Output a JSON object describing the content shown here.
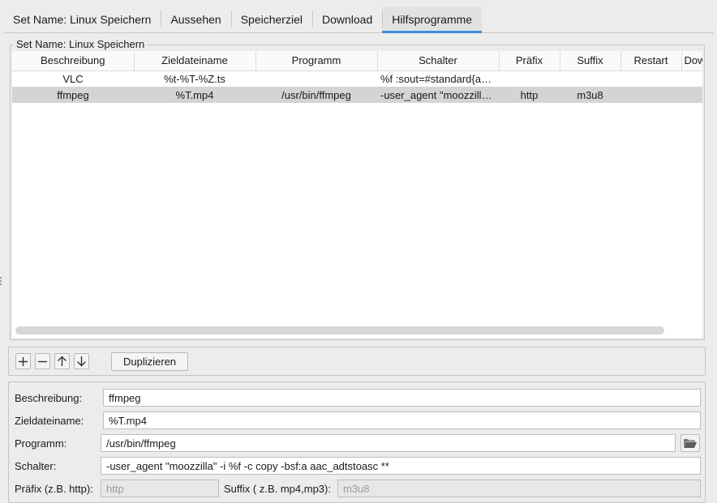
{
  "tabs": [
    {
      "label": "Set Name: Linux Speichern"
    },
    {
      "label": "Aussehen"
    },
    {
      "label": "Speicherziel"
    },
    {
      "label": "Download"
    },
    {
      "label": "Hilfsprogramme"
    }
  ],
  "group_title": "Set Name: Linux Speichern",
  "table": {
    "columns": [
      "Beschreibung",
      "Zieldateiname",
      "Programm",
      "Schalter",
      "Präfix",
      "Suffix",
      "Restart",
      "Dow"
    ],
    "rows": [
      [
        "VLC",
        "%t-%T-%Z.ts",
        "",
        "%f :sout=#standard{ac…",
        "",
        "",
        "",
        ""
      ],
      [
        "ffmpeg",
        "%T.mp4",
        "/usr/bin/ffmpeg",
        "-user_agent \"moozzilla…",
        "http",
        "m3u8",
        "",
        ""
      ]
    ],
    "selected_row": 1
  },
  "toolbar": {
    "add_icon": "plus-icon",
    "remove_icon": "minus-icon",
    "up_icon": "arrow-up-icon",
    "down_icon": "arrow-down-icon",
    "duplicate_label": "Duplizieren"
  },
  "form": {
    "beschreibung_label": "Beschreibung:",
    "beschreibung_value": "ffmpeg",
    "zieldateiname_label": "Zieldateiname:",
    "zieldateiname_value": "%T.mp4",
    "programm_label": "Programm:",
    "programm_value": "/usr/bin/ffmpeg",
    "folder_icon": "folder-open-icon",
    "schalter_label": "Schalter:",
    "schalter_value": "-user_agent \"moozzilla\" -i %f -c copy -bsf:a aac_adtstoasc **",
    "praefix_label": "Präfix (z.B. http):",
    "praefix_value": "http",
    "suffix_label": "Suffix ( z.B. mp4,mp3):",
    "suffix_value": "m3u8"
  },
  "colors": {
    "accent": "#3e8fd6",
    "selected_row": "#d4d4d4",
    "background": "#ececec"
  }
}
